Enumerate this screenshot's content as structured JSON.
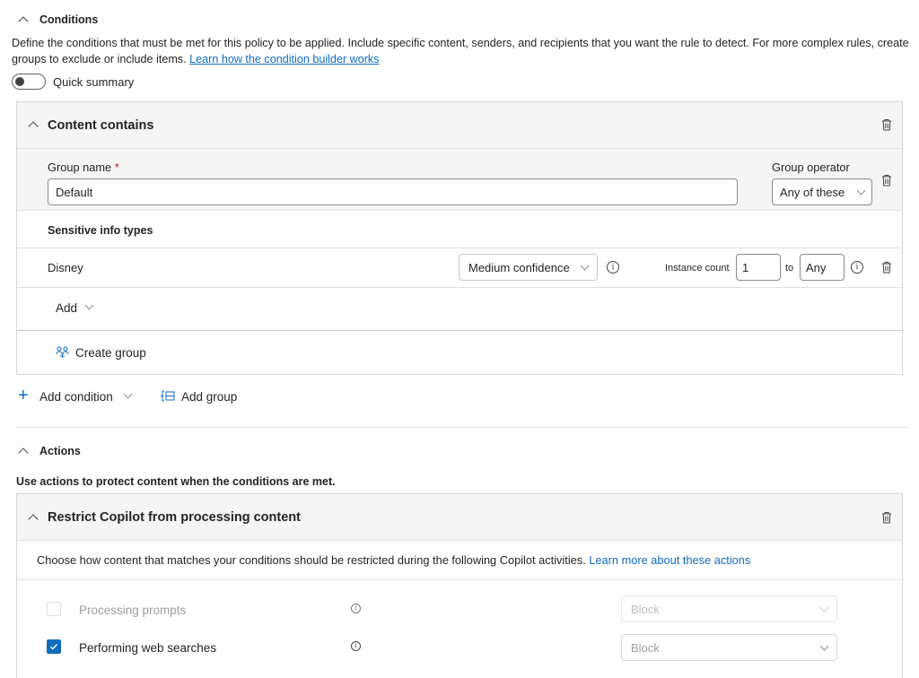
{
  "conditions": {
    "title": "Conditions",
    "description": "Define the conditions that must be met for this policy to be applied. Include specific content, senders, and recipients that you want the rule to detect. For more complex rules, create groups to exclude or include items.",
    "learn_link": "Learn how the condition builder works",
    "quick_summary_label": "Quick summary",
    "quick_summary_on": false,
    "card": {
      "title": "Content contains",
      "group_name_label": "Group name",
      "required_mark": "*",
      "group_name_value": "Default",
      "group_operator_label": "Group operator",
      "group_operator_value": "Any of these",
      "sit_header": "Sensitive info types",
      "sit_row": {
        "name": "Disney",
        "confidence": "Medium confidence",
        "instance_label": "Instance count",
        "instance_min": "1",
        "to_label": "to",
        "instance_max": "Any"
      },
      "add_label": "Add",
      "create_group_label": "Create group"
    },
    "add_condition_label": "Add condition",
    "add_group_label": "Add group"
  },
  "actions": {
    "title": "Actions",
    "description": "Use actions to protect content when the conditions are met.",
    "card": {
      "title": "Restrict Copilot from processing content",
      "description": "Choose how content that matches your conditions should be restricted during the following Copilot activities.",
      "learn_link": "Learn more about these actions",
      "items": [
        {
          "label": "Processing prompts",
          "checked": false,
          "disabled": true,
          "action": "Block"
        },
        {
          "label": "Performing web searches",
          "checked": true,
          "disabled": false,
          "action": "Block"
        }
      ]
    }
  },
  "colors": {
    "accent": "#0f6cbd",
    "checkbox": "#0f6cbd",
    "required": "#c50f1f"
  }
}
